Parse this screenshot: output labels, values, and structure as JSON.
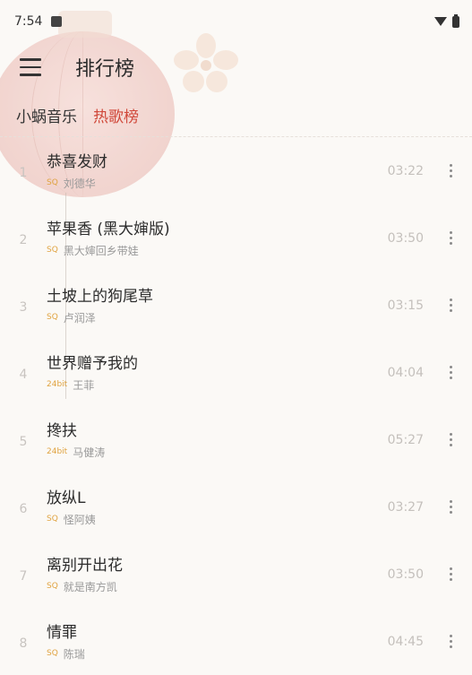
{
  "status_bar": {
    "time": "7:54"
  },
  "toolbar": {
    "title": "排行榜"
  },
  "tabs": [
    {
      "label": "小蜗音乐",
      "active": false
    },
    {
      "label": "热歌榜",
      "active": true
    }
  ],
  "colors": {
    "accent": "#d0483a",
    "quality": "#e0a340",
    "background": "#fbf9f6"
  },
  "songs": [
    {
      "rank": "1",
      "title": "恭喜发财",
      "quality": "SQ",
      "artist": "刘德华",
      "duration": "03:22"
    },
    {
      "rank": "2",
      "title": "苹果香 (黑大婶版)",
      "quality": "SQ",
      "artist": "黑大婶回乡带娃",
      "duration": "03:50"
    },
    {
      "rank": "3",
      "title": "土坡上的狗尾草",
      "quality": "SQ",
      "artist": "卢润泽",
      "duration": "03:15"
    },
    {
      "rank": "4",
      "title": "世界赠予我的",
      "quality": "24bit",
      "artist": "王菲",
      "duration": "04:04"
    },
    {
      "rank": "5",
      "title": "搀扶",
      "quality": "24bit",
      "artist": "马健涛",
      "duration": "05:27"
    },
    {
      "rank": "6",
      "title": "放纵L",
      "quality": "SQ",
      "artist": "怪阿姨",
      "duration": "03:27"
    },
    {
      "rank": "7",
      "title": "离别开出花",
      "quality": "SQ",
      "artist": "就是南方凯",
      "duration": "03:50"
    },
    {
      "rank": "8",
      "title": "情罪",
      "quality": "SQ",
      "artist": "陈瑞",
      "duration": "04:45"
    }
  ]
}
